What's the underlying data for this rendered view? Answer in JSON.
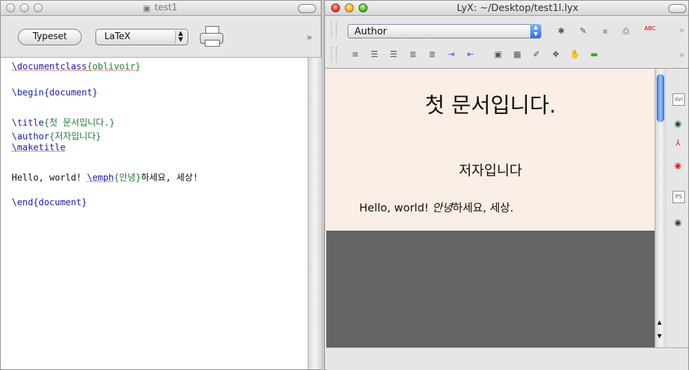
{
  "left_window": {
    "title": "test1",
    "toolbar": {
      "typeset_label": "Typeset",
      "engine_value": "LaTeX",
      "chevron": "»"
    },
    "source": {
      "line1_cmd": "\\documentclass",
      "line1_arg": "{oblivoir}",
      "line2": "\\begin{document}",
      "line3_cmd": "\\title",
      "line3_arg": "{첫 문서입니다.}",
      "line4_cmd": "\\author",
      "line4_arg": "{저자입니다}",
      "line5": "\\maketitle",
      "line6_text": "Hello, world! ",
      "line6_cmd": "\\emph",
      "line6_arg": "{안녕}",
      "line6_rest": "하세요, 세상!",
      "line7": "\\end{document}"
    }
  },
  "right_window": {
    "title": "LyX: ~/Desktop/test1l.lyx",
    "layout_select": "Author",
    "chevron": "»",
    "document": {
      "title": "첫 문서입니다.",
      "author": "저자입니다",
      "body_prefix": "Hello, world! ",
      "body_emph": "안녕",
      "body_suffix": "하세요, 세상."
    },
    "side_icons": [
      "dvi-icon",
      "dvi-view-icon",
      "pdf-icon",
      "pdf-view-icon",
      "ps-icon",
      "ps-view-icon"
    ],
    "side_icon_labels": [
      "dvi",
      "",
      "",
      "",
      "PS",
      ""
    ]
  },
  "colors": {
    "editor_cmd": "#1a1ab0",
    "editor_brace": "#1d7c3a",
    "doc_bg": "#faeee6",
    "gray_area": "#646464"
  }
}
